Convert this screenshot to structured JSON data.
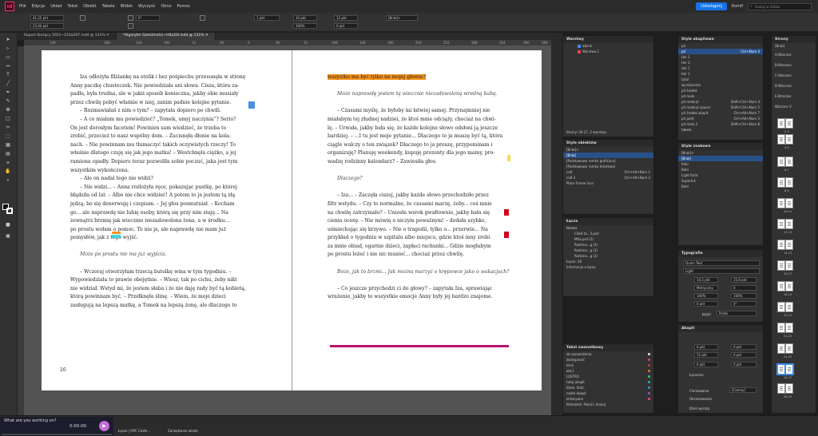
{
  "app": {
    "logo": "Id"
  },
  "menu": [
    "Plik",
    "Edycja",
    "Układ",
    "Tekst",
    "Obiekt",
    "Tabela",
    "Widok",
    "Wyczyść",
    "Okno",
    "Pomoc"
  ],
  "topbar": {
    "publish": "Udostępnij",
    "workspace": "Komif",
    "search_placeholder": "Szukaj w Adobe"
  },
  "control": {
    "x": "41,25 pkt",
    "y": "23,44 pkt",
    "f1": "1 pkt",
    "f2": "10 pkt",
    "zoom": "100%",
    "style": "[Brak]+",
    "angle": "0°",
    "f3": "12 pkt",
    "f4": "0 pkt"
  },
  "tabs": [
    {
      "label": "Raport bieżący 2021~210a297.indd @ 131% ✕"
    },
    {
      "label": "*Algorytm Samotności~H0a20l.indd @ 131% ✕"
    }
  ],
  "ruler": [
    "144",
    "",
    "180",
    "144",
    "100",
    "72",
    "36",
    "0",
    "36",
    "72",
    "108",
    "144",
    "180",
    "216",
    "252",
    "288",
    "324",
    "360",
    "396",
    "432"
  ],
  "left_page": {
    "lines": [
      "Iza odłożyła filiżankę na stolik i bez pośpiechu przesunęła w stronę",
      "Anny paczkę chusteczek. Nie powiedziała ani słowa. Cisza, która za-",
      "padła, była trudna, ale w jakiś sposób konieczna, jakby obie musiały",
      "przez chwilę pobyć właśnie w niej, zanim padnie kolejne pytanie.",
      "– Rozmawiałaś z nim o tym? – zapytała dopiero po chwili.",
      "– A co miałam mu powiedzieć? „Tomek, umyj naczynia”? Serio?",
      "On jest dorosłym facetem! Powinien sam wiedzieć, że trzeba to",
      "zrobić, przecież to nasz wspólny dom. – Zacisnęła dłonie na kola-",
      "nach. – Nie powinnam mu tłumaczyć takich oczywistych rzeczy! To",
      "właśnie dlatego czuję się jak jego matka! – Westchnęła ciężko, a jej",
      "ramiona opadły. Dopiero teraz pozwoliła sobie poczuć, jaka jest tym",
      "wszystkim wykończona.",
      "– Ale on nadal tego nie widzi?",
      "– Nie widzi... – Anna rozłożyła ręce, pokazując pustkę, po której",
      "błądziła od lat. – Albo nie chce widzieć! A potem to ja jestem tą złą",
      "jędzą, bo się denerwuję i czepiam. – Jej głos posmutniał. – Kocham",
      "go... ale naprawdę nie lubię osoby, którą się przy nim staję... Na",
      "zewnątrz brzmię jak wiecznie niezadowolona żona, a w środku...",
      "po prostu wołam o pomoc. To nie ja, ale naprawdę nie mam już",
      "pomysłów, jak z tego wyjść."
    ],
    "italic": "Może po prostu nie ma już wyjścia.",
    "lines2": [
      "– Wczoraj otworzyłam trzecią butelkę wina w tym tygodniu. –",
      "Wypowiedziała to prawie obojętnie. – Wiesz, tak po cichu, żeby nikt",
      "nie widział. Wstyd mi, że jestem słaba i że nie daję rady być tą kobietą,",
      "którą powinnam być. – Przełknęła ślinę. – Wiem, że moje dzieci",
      "zasługują na lepszą matkę, a Tomek na lepszą żonę, ale dlaczego to"
    ],
    "page_number": "26"
  },
  "right_page": {
    "headline": "wszystko ma być tylko na mojej głowie?",
    "italic1": "Może naprawdę jestem tą wiecznie niezadowoloną wredną babą.",
    "lines": [
      "– Czasami myślę, że byłoby mi łatwiej samej. Przynajmniej nie",
      "miałabym tej złudnej nadziei, że ktoś mnie odciąży, chociaż na chwi-",
      "lę. – Urwała, jakby bała się, że każde kolejne słowo odsłoni ją jeszcze",
      "bardziej. – ...I tu jest moje pytanie... Dlaczego to ja muszę być tą, która",
      "ciągle walczy o ten związek? Dlaczego to ja proszę, przypominam i",
      "organizuję? Planuję weekendy, kupuję prezenty dla jego mamy, pro-",
      "wadzę rodzinny kalendarz? – Zawiesiła głos."
    ],
    "italic2": "Dlaczego?",
    "lines2": [
      "– Iza... – Zaczęła ciszej, jakby każde słowo przechodziło przez",
      "filtr wstydu. – Czy to normalne, że czasami marzę, żeby... coś mnie",
      "na chwilę zatrzymało? – Uniosła wzrok gwałtownie, jakby bała się",
      "cienia oceny. – Nie mówię o niczym poważnym! – dodała szybko,",
      "uśmiechając się krzywo. – Nie o tragedii, tylko o... przerwie... Na",
      "przykład o tygodniu w szpitalu albo miejscu, gdzie ktoś inny zrobi",
      "za mnie obiad, ogarnie dzieci, zapłaci rachunki... Gdzie mogłabym",
      "po prostu leżeć i nie nic musieć... chociaż przez chwilę."
    ],
    "italic3": "Boże, jak to brzmi... Jak można marzyć o krępowce jako o wakacjach?",
    "lines3": [
      "– Co jeszcze przychodzi ci do głowy? – zapytała Iza, sprawiając",
      "wrażenie, jakby te wszystkie emocje Anny były jej bardzo znajome."
    ]
  },
  "layers": {
    "title": "Warstwy",
    "items": [
      "abcnk",
      "Warstwa 1"
    ],
    "footer": "Strony: 26-27, 2 warstwy"
  },
  "object_styles": {
    "title": "Style obiektów",
    "items": [
      "[Brak]+",
      "[Brak]",
      "[Podstawowa ramka graficzna]",
      "[Podstawowa ramka tekstowa]",
      "całt",
      "całt 2",
      "Place Frame Icon"
    ],
    "shortcuts": [
      "",
      "",
      "",
      "",
      "Ctrl+Alt+Num 1",
      "Ctrl+Alt+Num 2",
      ""
    ]
  },
  "links": {
    "title": "Łącza",
    "header": "Nazwa",
    "items": [
      "Cited ta...3.psd",
      "Mtla.psd (2)",
      "Rodzina...g (2)",
      "Rodzina...g (2)",
      "Rodzina...g (2)"
    ],
    "footer": "Łącza: 26",
    "info": "Informacje o łączu"
  },
  "paragraph_styles": {
    "title": "Style akapitowe",
    "items": [
      "p4",
      "p4",
      "tier 2",
      "tier 3",
      "tier 1",
      "tier 1",
      "tytuł",
      "wyróżnienie",
      "p4 środek",
      "p4 mała",
      "p4 małoryt",
      "p4 małoryt spacer",
      "p4 środek akapit",
      "p4 podt",
      "p4 mała 2",
      "tabela"
    ],
    "shortcuts": [
      "",
      "Ctrl+Num 4",
      "",
      "",
      "",
      "",
      "",
      "",
      "",
      "",
      "Shift+Ctrl+Num 4",
      "Shift+Ctrl+Num 5",
      "Ctrl+Alt+Num 7",
      "Ctrl+Alt+Num 3",
      "Shift+Ctrl+Num 8",
      ""
    ]
  },
  "char_styles": {
    "title": "Style znakowe",
    "items": [
      "[Brak]+",
      "[Brak]",
      "Italic",
      "Bold",
      "Light Italic",
      "Superkrk",
      "Bold"
    ]
  },
  "typography": {
    "title": "Typografia",
    "font": "Quinn Text",
    "style": "Light",
    "size": "10,5 pkt",
    "leading": "15,6 pkt",
    "kern": "Metryczny",
    "track": "0",
    "vscale": "100%",
    "hscale": "100%",
    "baseline": "0 pkt",
    "skew": "0°",
    "lang": "Polski",
    "lang_label": "Język:"
  },
  "paragraph": {
    "title": "Akapit",
    "f1": "0 pkt",
    "f2": "0 pkt",
    "f3": "12 pkt",
    "f4": "0 pkt",
    "f5": "0 pkt",
    "f6": "0 pkt",
    "hyphen": "Łączenie",
    "shading": "Cieniowanie",
    "border": "Obramowanie",
    "grid": "Dziel wyrazy",
    "none": "[Czarny]"
  },
  "swatches": {
    "title": "Tekst swanotkowy",
    "items": [
      "do sprawdzenia",
      "dostępność",
      "druk",
      "abc1",
      "LUSTRO",
      "tutaj akapit",
      "Stale, Italic",
      "nadal akapit",
      "zmiaryana"
    ],
    "colors": [
      "#e8e8e8",
      "#e83e8c",
      "#c0392b",
      "#e67e22",
      "#2ecc71",
      "#1abc9c",
      "#3498db",
      "#9b59b6",
      "#ff4081"
    ],
    "footer_label": "Wskaźnik:",
    "footer_value": "Pokaż i drukuj"
  },
  "pages": {
    "title": "Strony",
    "none": "[Brak]",
    "masters": [
      "A-Wzorzec",
      "B-Wzorzec",
      "C-Wzorzec",
      "D-Wzorzec",
      "E-Wzorzec",
      "F-Wzorzec"
    ],
    "section": "Wzorzec V",
    "numbers": [
      "2-3",
      "4-5",
      "6-7",
      "8-9",
      "10-11",
      "12-13",
      "14-15",
      "16-17",
      "18-19",
      "20-21",
      "22-23",
      "24-25",
      "26-27",
      "28-29"
    ]
  },
  "status": {
    "zoom": "131%",
    "page": "26",
    "profile": "Łącze | OPC CoVer...",
    "mode": "Zarządzanie wiedą"
  },
  "video": {
    "title": "What are you working on?",
    "time": "0:00:00",
    "progress": 0.0
  }
}
